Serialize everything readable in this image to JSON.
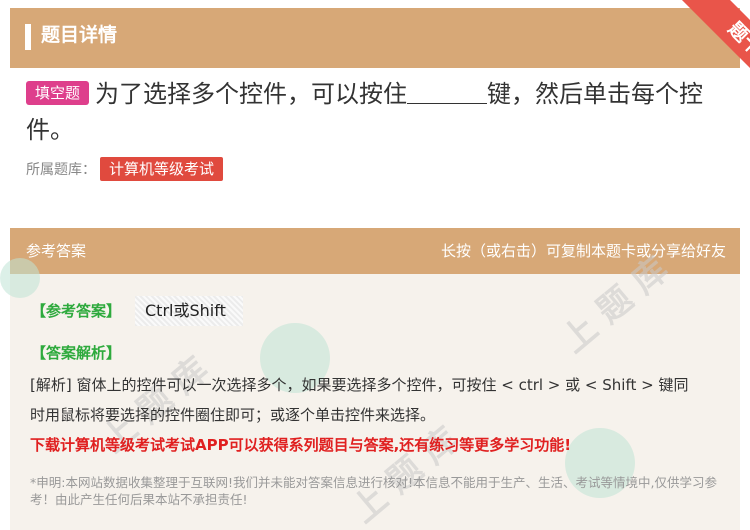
{
  "header": {
    "title": "题目详情",
    "ribbon": "题卡"
  },
  "question": {
    "tag": "填空题",
    "text_before": "为了选择多个控件，可以按住",
    "text_after": "键，然后单击每个控件。"
  },
  "bank": {
    "label": "所属题库：",
    "name": "计算机等级考试"
  },
  "answer_panel": {
    "label": "参考答案",
    "share_tip": "长按（或右击）可复制本题卡或分享给好友",
    "answer_title": "【参考答案】",
    "answer_value": "Ctrl或Shift",
    "analysis_title": "【答案解析】",
    "analysis_text": "[解析] 窗体上的控件可以一次选择多个，如果要选择多个控件，可按住 < ctrl > 或 < Shift > 键同时用鼠标将要选择的控件圈住即可；或逐个单击控件来选择。",
    "promo": "下载计算机等级考试考试APP可以获得系列题目与答案,还有练习等更多学习功能!",
    "disclaimer": "*申明:本网站数据收集整理于互联网!我们并未能对答案信息进行核对!本信息不能用于生产、生活、考试等情境中,仅供学习参考！由此产生任何后果本站不承担责任!"
  },
  "colors": {
    "header": "#d7a877",
    "tag": "#de3f8c",
    "bank_tag": "#e04a3e",
    "green": "#2eaa3d",
    "promo": "#e02020"
  }
}
